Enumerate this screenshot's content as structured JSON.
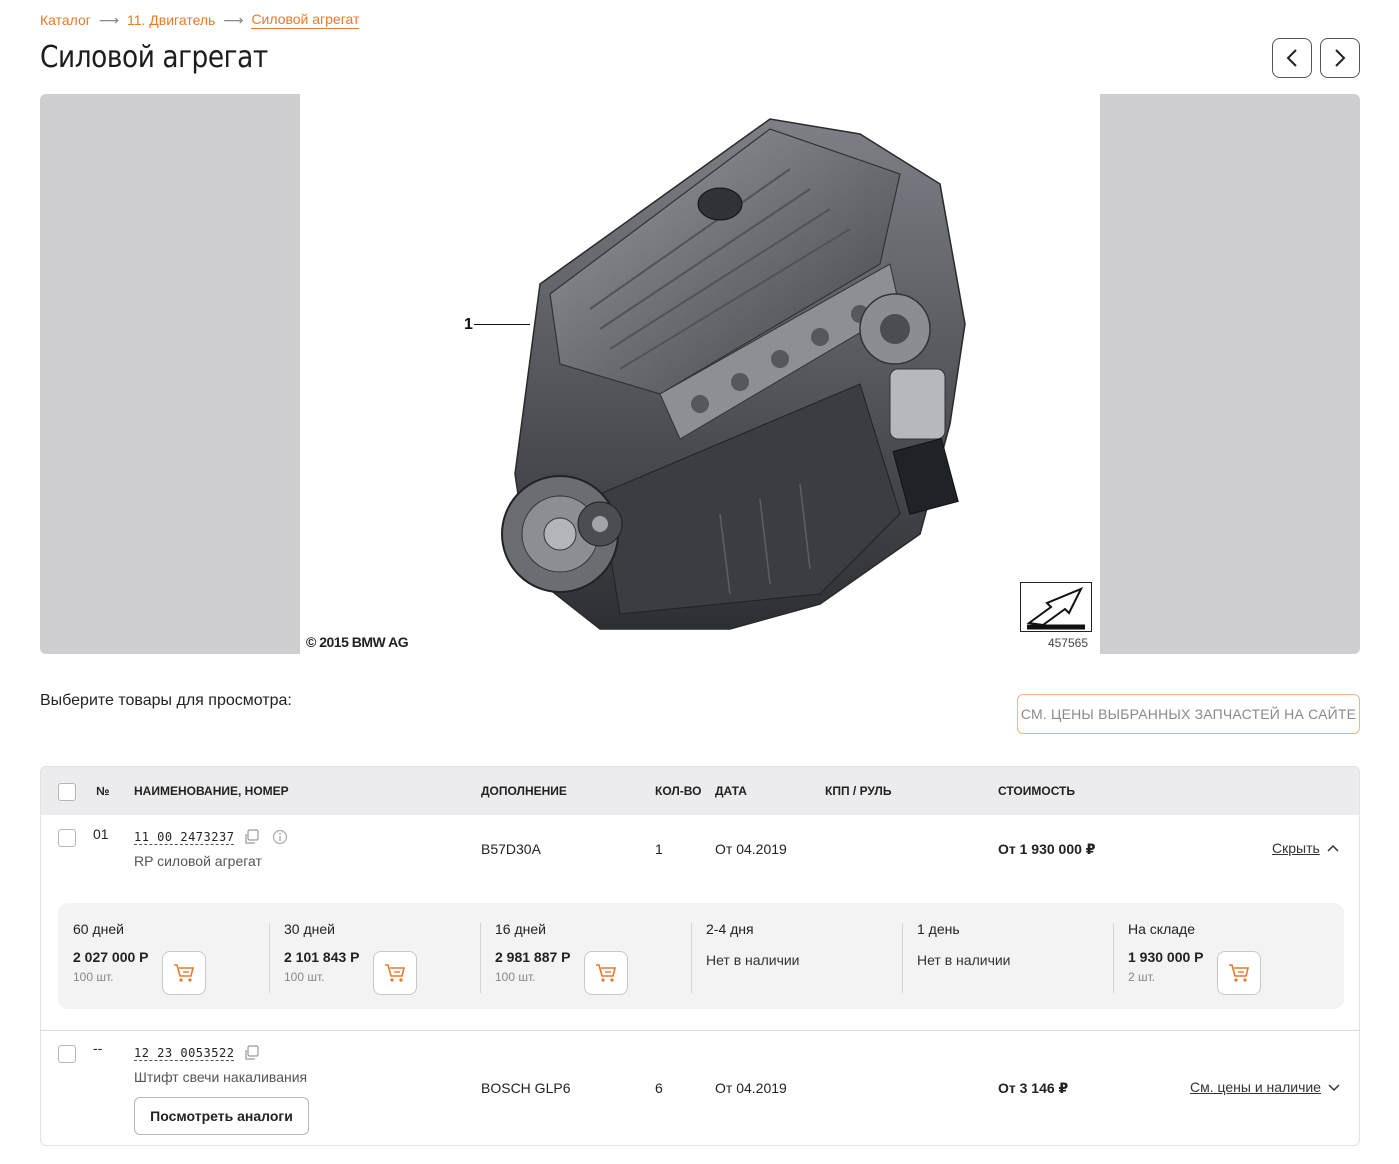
{
  "breadcrumb": {
    "items": [
      "Каталог",
      "11. Двигатель",
      "Силовой агрегат"
    ],
    "separator": "⟶"
  },
  "page": {
    "title": "Силовой агрегат"
  },
  "diagram": {
    "copyright": "© 2015 BMW AG",
    "diagram_id": "457565",
    "callout": "1"
  },
  "selection": {
    "label": "Выберите товары для просмотра:",
    "prices_button": "СМ. ЦЕНЫ ВЫБРАННЫХ ЗАПЧАСТЕЙ НА САЙТЕ"
  },
  "table": {
    "headers": {
      "num": "№",
      "name": "НАИМЕНОВАНИЕ, НОМЕР",
      "extra": "ДОПОЛНЕНИЕ",
      "qty": "КОЛ-ВО",
      "date": "ДАТА",
      "gearbox": "КПП / РУЛЬ",
      "cost": "СТОИМОСТЬ"
    },
    "rows": [
      {
        "num": "01",
        "part_number": "11 00 2473237",
        "name": "RP силовой агрегат",
        "extra": "B57D30A",
        "qty": "1",
        "date": "От 04.2019",
        "gearbox": "",
        "cost": "От 1 930 000 ₽",
        "toggle": "Скрыть",
        "offers": [
          {
            "term": "60 дней",
            "price": "2 027 000 Р",
            "qty": "100 шт."
          },
          {
            "term": "30 дней",
            "price": "2 101 843 Р",
            "qty": "100 шт."
          },
          {
            "term": "16 дней",
            "price": "2 981 887 Р",
            "qty": "100 шт."
          },
          {
            "term": "2-4 дня",
            "status": "Нет в наличии"
          },
          {
            "term": "1 день",
            "status": "Нет в наличии"
          },
          {
            "term": "На складе",
            "price": "1 930 000 Р",
            "qty": "2 шт."
          }
        ]
      },
      {
        "num": "--",
        "part_number": "12 23 0053522",
        "name": "Штифт свечи накаливания",
        "extra": "BOSCH GLP6",
        "qty": "6",
        "date": "От 04.2019",
        "gearbox": "",
        "cost": "От 3 146 ₽",
        "toggle": "См. цены и наличие",
        "analogs_button": "Посмотреть аналоги"
      }
    ]
  },
  "colors": {
    "accent": "#e8792b",
    "accent_light": "#f0b48a",
    "header_bg": "#ececee",
    "offers_bg": "#f3f3f4",
    "viewer_bg": "#cfcfd1"
  }
}
